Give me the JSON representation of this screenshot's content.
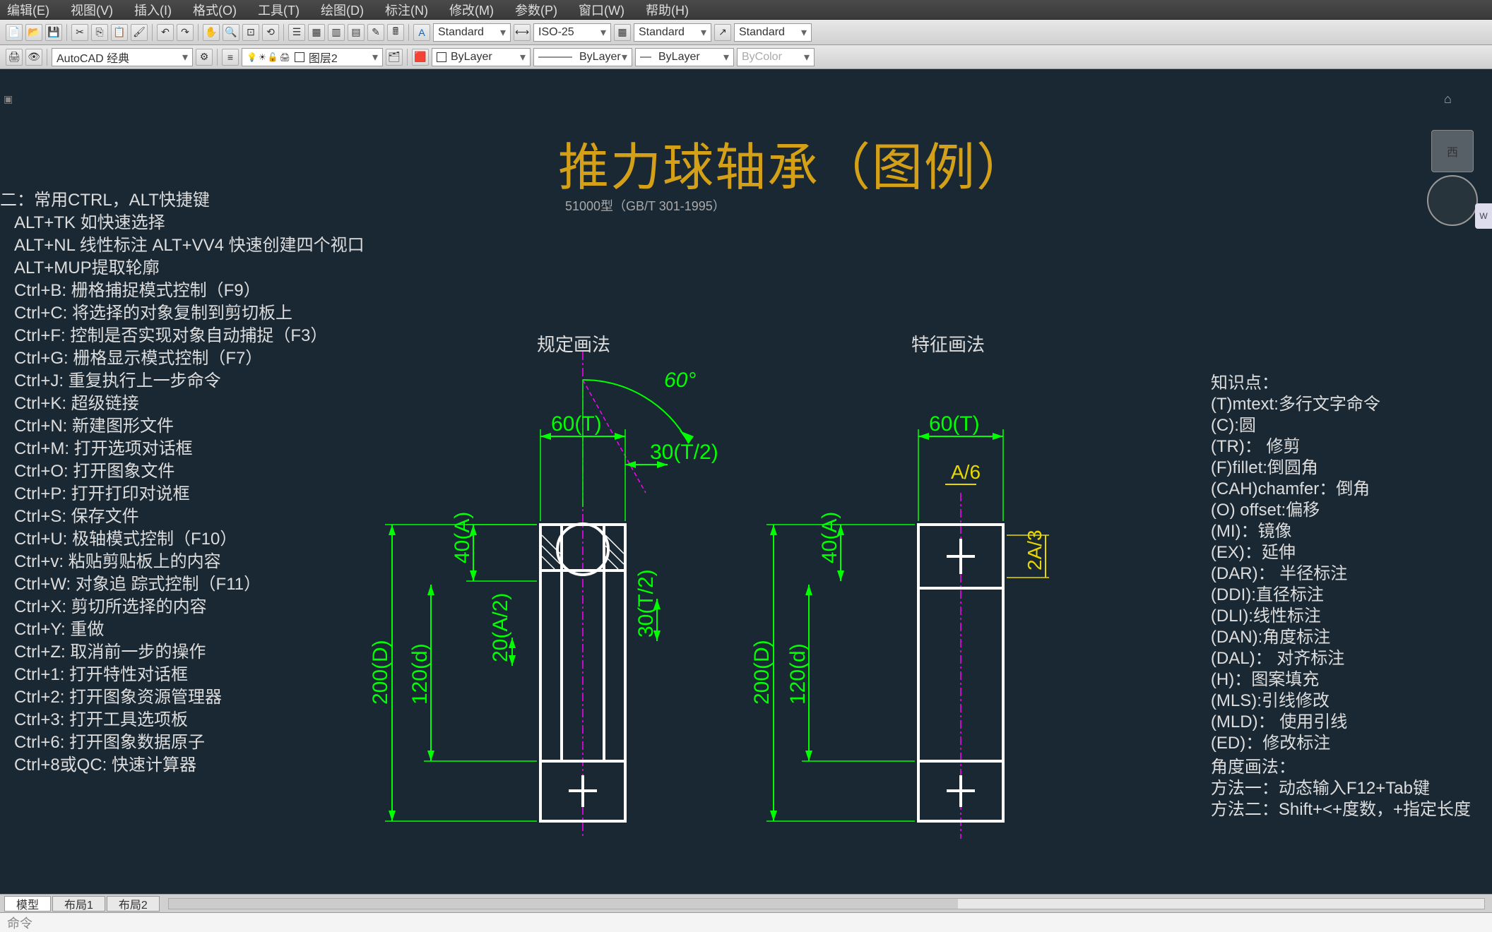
{
  "menu": {
    "items": [
      "编辑(E)",
      "视图(V)",
      "插入(I)",
      "格式(O)",
      "工具(T)",
      "绘图(D)",
      "标注(N)",
      "修改(M)",
      "参数(P)",
      "窗口(W)",
      "帮助(H)"
    ]
  },
  "toolbar": {
    "textstyle": "Standard",
    "dimstyle": "ISO-25",
    "tablestyle": "Standard",
    "mleaderstyle": "Standard",
    "workspace": "AutoCAD 经典",
    "layer": "图层2",
    "color": "ByLayer",
    "linetype": "ByLayer",
    "lineweight": "ByLayer",
    "plotstyle": "ByColor"
  },
  "canvas": {
    "title": "推力球轴承（图例）",
    "subtitle": "51000型（GB/T 301-1995）",
    "left_label": "规定画法",
    "right_label": "特征画法",
    "angle_label": "60°",
    "dims": {
      "T60": "60(T)",
      "T30": "30(T/2)",
      "A40": "40(A)",
      "A20": "20(A/2)",
      "T30v": "30(T/2)",
      "D200": "200(D)",
      "d120": "120(d)",
      "A_over_6": "A/6",
      "two_A_over_3": "2A/3"
    }
  },
  "shortcuts": {
    "heading": "二：常用CTRL，ALT快捷键",
    "lines": [
      "ALT+TK 如快速选择",
      "ALT+NL 线性标注 ALT+VV4 快速创建四个视口",
      "ALT+MUP提取轮廓",
      "Ctrl+B: 栅格捕捉模式控制（F9）",
      "Ctrl+C: 将选择的对象复制到剪切板上",
      "Ctrl+F: 控制是否实现对象自动捕捉（F3）",
      "Ctrl+G: 栅格显示模式控制（F7）",
      "Ctrl+J: 重复执行上一步命令",
      "Ctrl+K: 超级链接",
      "Ctrl+N: 新建图形文件",
      "Ctrl+M: 打开选项对话框",
      "Ctrl+O: 打开图象文件",
      "Ctrl+P: 打开打印对说框",
      "Ctrl+S: 保存文件",
      "Ctrl+U: 极轴模式控制（F10）",
      "Ctrl+v: 粘贴剪贴板上的内容",
      "Ctrl+W: 对象追 踪式控制（F11）",
      "Ctrl+X: 剪切所选择的内容",
      "Ctrl+Y: 重做",
      "Ctrl+Z: 取消前一步的操作",
      "Ctrl+1: 打开特性对话框",
      "Ctrl+2: 打开图象资源管理器",
      "Ctrl+3: 打开工具选项板",
      "Ctrl+6: 打开图象数据原子",
      "Ctrl+8或QC: 快速计算器"
    ]
  },
  "knowledge": {
    "heading": "知识点：",
    "lines": [
      "(T)mtext:多行文字命令",
      "(C):圆",
      "(TR)： 修剪",
      "(F)fillet:倒圆角",
      "(CAH)chamfer：倒角",
      "(O) offset:偏移",
      "(MI)：镜像",
      "(EX)：延伸",
      "(DAR)： 半径标注",
      "(DDI):直径标注",
      "(DLI):线性标注",
      "(DAN):角度标注",
      "(DAL)： 对齐标注",
      "(H)：图案填充",
      "(MLS):引线修改",
      "(MLD)：  使用引线",
      "(ED)：修改标注"
    ],
    "angle_heading": "角度画法：",
    "angle_lines": [
      "方法一：动态输入F12+Tab键",
      "方法二：Shift+<+度数，+指定长度"
    ]
  },
  "tabs": {
    "items": [
      "模型",
      "布局1",
      "布局2"
    ],
    "active": 0
  },
  "cmdline": "命令",
  "nav": {
    "cube": "西",
    "wp": "W"
  },
  "chart_data": {
    "type": "diagram",
    "title": "推力球轴承（图例）",
    "standard": "51000型 GB/T 301-1995",
    "views": [
      {
        "name": "规定画法",
        "dimensions": {
          "T": 60,
          "T_half": 30,
          "A": 40,
          "A_half": 20,
          "D": 200,
          "d": 120,
          "angle_deg": 60
        }
      },
      {
        "name": "特征画法",
        "dimensions": {
          "T": 60,
          "A_over_6": "A/6",
          "two_A_over_3": "2A/3",
          "A": 40,
          "D": 200,
          "d": 120
        }
      }
    ]
  }
}
